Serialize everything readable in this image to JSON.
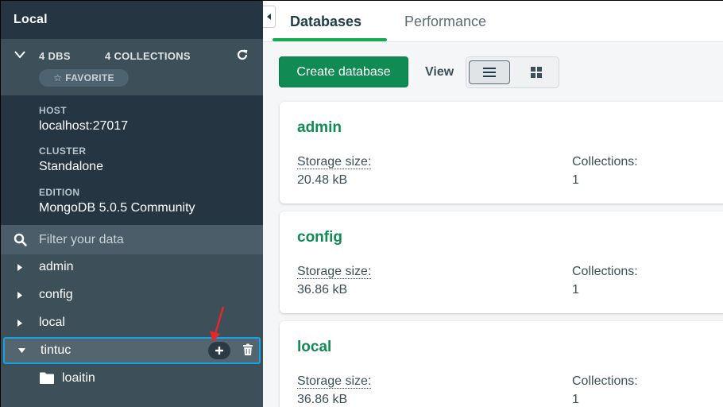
{
  "sidebar": {
    "title": "Local",
    "summary": {
      "dbs": "4 DBS",
      "collections": "4 COLLECTIONS",
      "favorite": "FAVORITE"
    },
    "info": [
      {
        "label": "HOST",
        "value": "localhost:27017"
      },
      {
        "label": "CLUSTER",
        "value": "Standalone"
      },
      {
        "label": "EDITION",
        "value": "MongoDB 5.0.5 Community"
      }
    ],
    "filter_placeholder": "Filter your data",
    "databases": [
      {
        "name": "admin"
      },
      {
        "name": "config"
      },
      {
        "name": "local"
      },
      {
        "name": "tintuc",
        "expanded": true,
        "collections": [
          "loaitin"
        ]
      }
    ]
  },
  "main": {
    "tabs": [
      {
        "label": "Databases",
        "active": true
      },
      {
        "label": "Performance",
        "active": false
      }
    ],
    "toolbar": {
      "create_label": "Create database",
      "view_label": "View"
    },
    "cards": [
      {
        "name": "admin",
        "storage_label": "Storage size:",
        "storage_value": "20.48 kB",
        "collections_label": "Collections:",
        "collections_value": "1"
      },
      {
        "name": "config",
        "storage_label": "Storage size:",
        "storage_value": "36.86 kB",
        "collections_label": "Collections:",
        "collections_value": "1"
      },
      {
        "name": "local",
        "storage_label": "Storage size:",
        "storage_value": "36.86 kB",
        "collections_label": "Collections:",
        "collections_value": "1"
      }
    ]
  },
  "colors": {
    "sidebar_bg": "#3d4f58",
    "sidebar_dark": "#253542",
    "accent_green": "#0f8b53",
    "tab_underline": "#13aa52",
    "selection_border": "#13a4e8",
    "annotation_red": "#e8262b"
  }
}
